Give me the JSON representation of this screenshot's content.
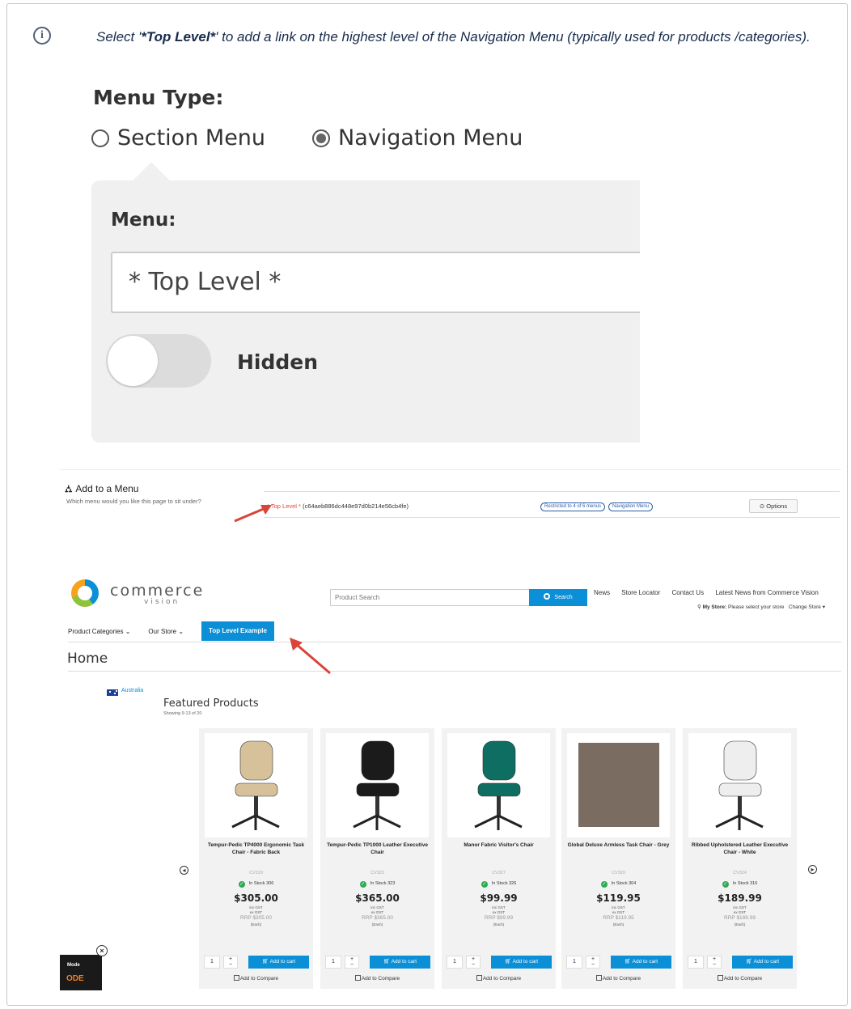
{
  "intro": {
    "prefix": "Select '",
    "emphasis": "*Top Level*",
    "suffix": "' to add a link on the highest level of the Navigation Menu (typically used for products /categories)."
  },
  "zoom": {
    "title": "Menu Type:",
    "radio_section": "Section Menu",
    "radio_navigation": "Navigation Menu",
    "selected": "Navigation Menu",
    "menu_label": "Menu:",
    "menu_value": "* Top Level *",
    "toggle_label": "Hidden",
    "toggle_on": false
  },
  "add_menu": {
    "title": "Add to a Menu",
    "subtitle": "Which menu would you like this page to sit under?",
    "value_star_open": "* Top Level *",
    "value_id": " (c64aeb886dc448e97d0b214e56cb4fe)",
    "pill_restricted": "Restricted to 4 of 6 menus",
    "pill_nav": "Navigation Menu",
    "options_label": "⊙ Options"
  },
  "store": {
    "logo_text": "commerce",
    "logo_sub": "vision",
    "search_placeholder": "Product Search",
    "search_button": "Search",
    "top_links": [
      "News",
      "Store Locator",
      "Contact Us",
      "Latest News from Commerce Vision"
    ],
    "my_store_label": "My Store:",
    "my_store_text": "Please select your store",
    "change_store": "Change Store",
    "nav": [
      "Product Categories",
      "Our Store",
      "Top Level Example"
    ],
    "page_title": "Home",
    "country": "Australia",
    "featured_title": "Featured Products",
    "featured_count": "Showing 9-13 of 20",
    "promo_line1": "Mode",
    "promo_line2": "ODE"
  },
  "products": [
    {
      "name": "Tempur-Pedic TP4000 Ergonomic Task Chair - Fabric Back",
      "code": "CV319",
      "stock": "In Stock 306",
      "price": "$305.00",
      "rrp": "RRP $305.00",
      "color": "#d7c19a"
    },
    {
      "name": "Tempur-Pedic TP1000 Leather Executive Chair",
      "code": "CV323",
      "stock": "In Stock 323",
      "price": "$365.00",
      "rrp": "RRP $365.00",
      "color": "#1b1b1b"
    },
    {
      "name": "Manor Fabric Visitor's Chair",
      "code": "CV327",
      "stock": "In Stock 326",
      "price": "$99.99",
      "rrp": "RRP $99.99",
      "color": "#0f6e62"
    },
    {
      "name": "Global Deluxe Armless Task Chair - Grey",
      "code": "CV320",
      "stock": "In Stock 304",
      "price": "$119.95",
      "rrp": "RRP $119.95",
      "color": "#7a6c60"
    },
    {
      "name": "Ribbed Upholstered Leather Executive Chair - White",
      "code": "CV324",
      "stock": "In Stock 316",
      "price": "$189.99",
      "rrp": "RRP $189.99",
      "color": "#eeeeee"
    }
  ],
  "card_common": {
    "inc_gst": "inc GST",
    "ex_gst": "ex GST",
    "each": "(Each)",
    "qty": "1",
    "add_to_cart": "Add to cart",
    "add_to_compare": "Add to Compare"
  }
}
